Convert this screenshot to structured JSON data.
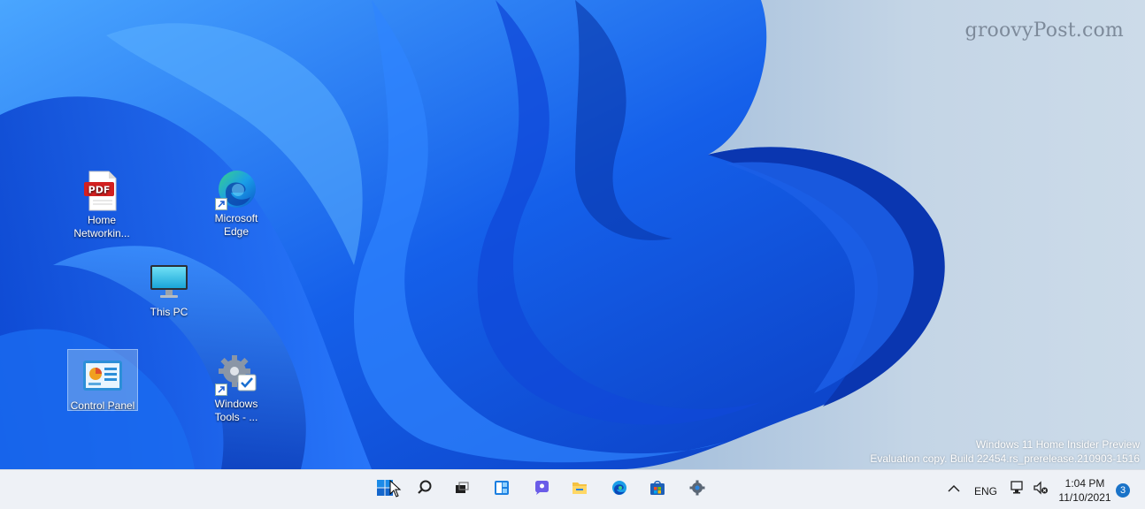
{
  "watermark": "groovyPost.com",
  "evaluation_notice": {
    "line1": "Windows 11 Home Insider Preview",
    "line2": "Evaluation copy. Build 22454.rs_prerelease.210903-1516"
  },
  "desktop_icons": {
    "pdf": {
      "line1": "Home",
      "line2": "Networkin...",
      "icon": "pdf-file-icon",
      "badge": "PDF"
    },
    "edge": {
      "line1": "Microsoft",
      "line2": "Edge",
      "icon": "edge-icon"
    },
    "this_pc": {
      "line1": "This PC",
      "icon": "monitor-icon"
    },
    "control_panel": {
      "line1": "Control Panel",
      "icon": "control-panel-icon",
      "selected": true
    },
    "windows_tools": {
      "line1": "Windows",
      "line2": "Tools - ...",
      "icon": "gear-icon"
    }
  },
  "taskbar": {
    "pinned": [
      "start-icon",
      "search-icon",
      "task-view-icon",
      "widgets-icon",
      "chat-icon",
      "file-explorer-icon",
      "edge-icon",
      "store-icon",
      "settings-icon"
    ],
    "tray": {
      "language": "ENG",
      "time": "1:04 PM",
      "date": "11/10/2021",
      "notification_count": "3"
    }
  },
  "colors": {
    "wallpaper_deep": "#0a3fc4",
    "wallpaper_light": "#2f8bff",
    "background": "#b9cde2",
    "taskbar": "#eef1f6",
    "notification_badge": "#1a73c8"
  }
}
